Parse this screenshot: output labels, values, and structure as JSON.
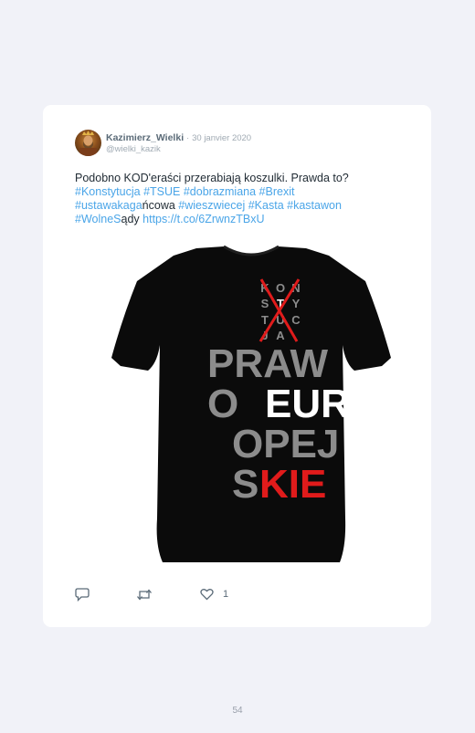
{
  "tweet": {
    "display_name": "Kazimierz_Wielki",
    "separator": "·",
    "date": "30 janvier 2020",
    "handle": "@wielki_kazik",
    "text_intro": "Podobno KOD'eraści przerabiają koszulki. Prawda to?",
    "tag_konstytucja": "#Konstytucja",
    "tag_tsue": "#TSUE",
    "tag_dobrazmiana": "#dobrazmiana",
    "tag_brexit": "#Brexit",
    "tag_ustawakaga_part": "#ustawakaga",
    "plain_ncowa": "ńcowa",
    "tag_wieszwiecej": "#wieszwiecej",
    "tag_kasta": "#Kasta",
    "tag_kastawon": "#kastawon",
    "tag_wolnes_part": "#WolneS",
    "plain_ady": "ądy",
    "link": "https://t.co/6ZrwnzTBxU",
    "like_count": "1"
  },
  "shirt_print": {
    "small_rows": [
      [
        "K",
        "O",
        "N"
      ],
      [
        "S",
        "T",
        "Y"
      ],
      [
        "T",
        "U",
        "C"
      ],
      [
        "J",
        "A",
        ""
      ]
    ],
    "line1": "PRAW",
    "line2_a": "O",
    "line2_b": "EUR",
    "line3": "OPEJ",
    "line4_a": "S",
    "line4_b": "KIE"
  },
  "footer": {
    "page_number": "54"
  },
  "icons": [
    "avatar",
    "reply-icon",
    "retweet-icon",
    "like-icon"
  ],
  "colors": {
    "background": "#f1f2f8",
    "card": "#ffffff",
    "link": "#4aa5e8",
    "shirt": "#0b0b0b",
    "print_gray": "#8c8c8c",
    "print_red": "#e01b1b"
  }
}
